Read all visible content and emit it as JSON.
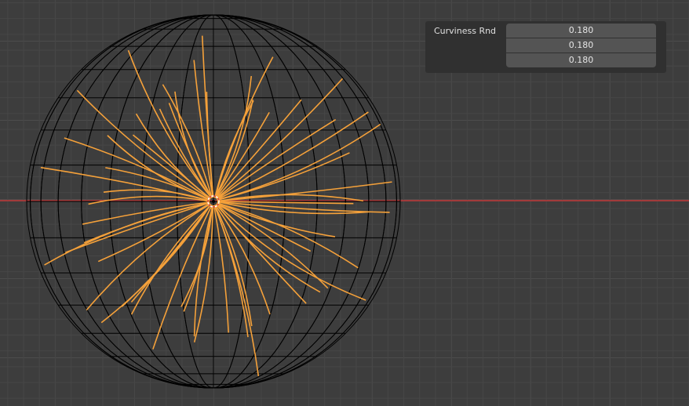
{
  "viewport": {
    "background": "#3d3d3d",
    "grid_minor": "#464646",
    "grid_major": "#4c4c4c",
    "axis_x_color": "#a13a3a"
  },
  "scene": {
    "sphere_wire_color": "#000000",
    "hair_color": "#f5a13a",
    "sphere_segments": 32,
    "sphere_rings": 16,
    "hair_strand_count": 60
  },
  "redo_panel": {
    "property_label": "Curviness Rnd",
    "values": [
      "0.180",
      "0.180",
      "0.180"
    ]
  }
}
